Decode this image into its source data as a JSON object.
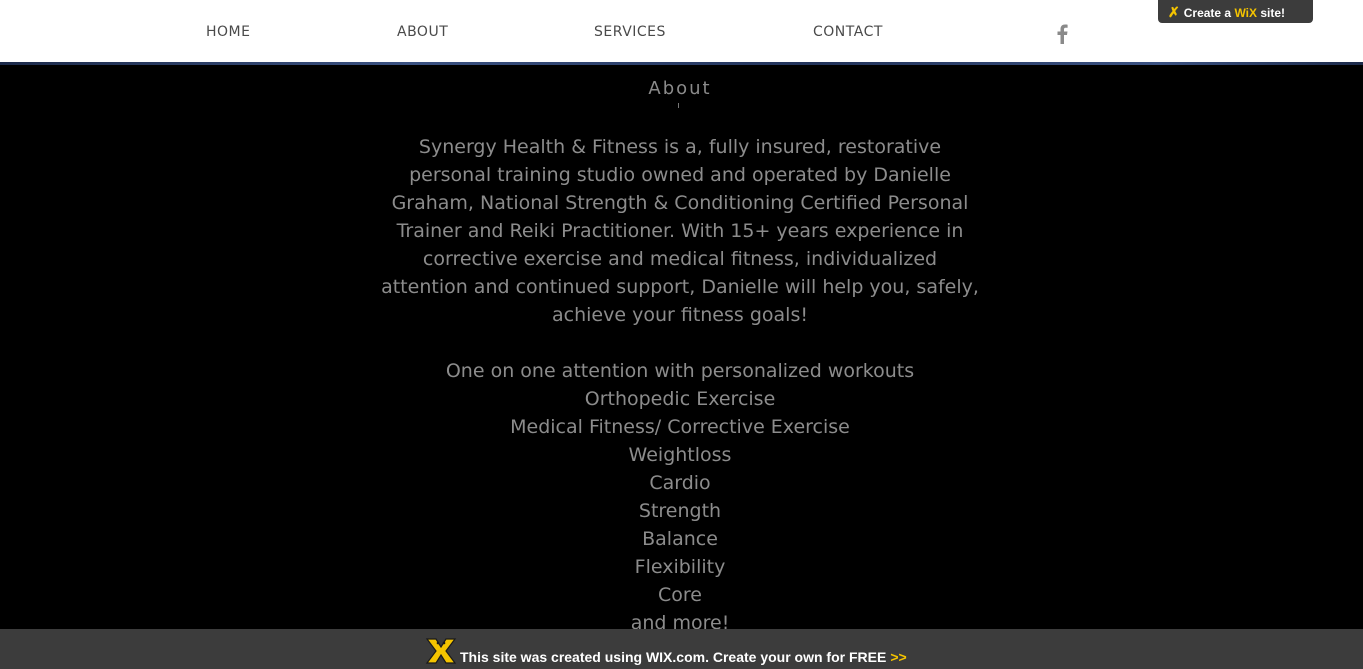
{
  "nav": {
    "items": [
      {
        "label": "HOME"
      },
      {
        "label": "ABOUT"
      },
      {
        "label": "SERVICES"
      },
      {
        "label": "CONTACT"
      }
    ],
    "social_icon": "facebook-icon"
  },
  "wix_badge": {
    "prefix": "Create a ",
    "brand": "WiX",
    "suffix": " site!"
  },
  "about": {
    "title": "About",
    "body": "Synergy Health & Fitness is a, fully insured, restorative personal training studio owned and operated by Danielle Graham, National Strength & Conditioning Certified Personal Trainer and Reiki Practitioner. With 15+ years experience in corrective exercise and medical fitness, individualized attention and continued support, Danielle will help you, safely, achieve your fitness goals!",
    "list": [
      "One on one attention with personalized workouts",
      "Orthopedic Exercise",
      "Medical Fitness/ Corrective Exercise",
      "Weightloss",
      "Cardio",
      "Strength",
      "Balance",
      "Flexibility",
      "Core",
      "and more!"
    ]
  },
  "bottom_banner": {
    "text": "This site was created using WIX.com. Create your own for FREE",
    "arrows": ">>"
  },
  "colors": {
    "nav_text": "#4a4a4a",
    "body_text": "#8c8c8c",
    "banner_bg": "#3c3c3c",
    "accent_yellow": "#f5c400",
    "header_rule": "#3b5282"
  }
}
